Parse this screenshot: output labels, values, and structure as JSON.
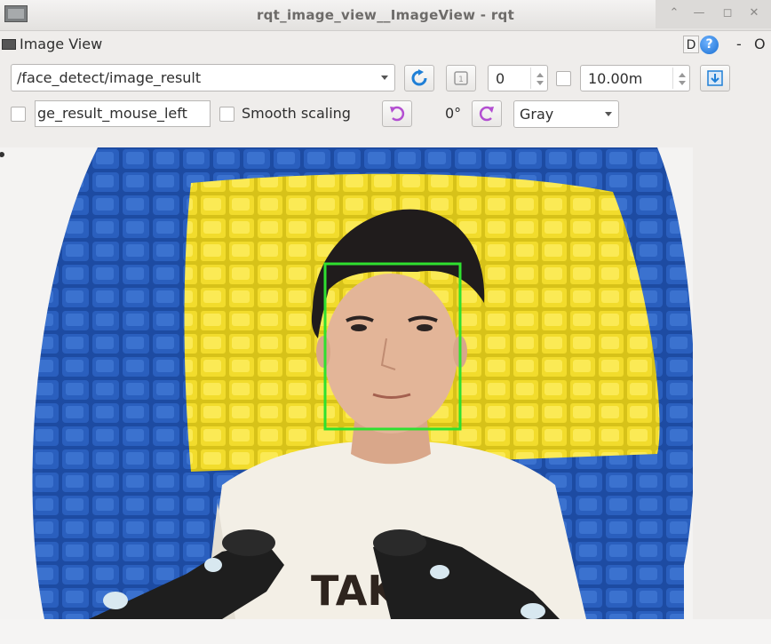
{
  "window": {
    "title": "rqt_image_view__ImageView - rqt"
  },
  "dock": {
    "title": "Image View",
    "d_label": "D",
    "help_label": "?",
    "dash_label": "-",
    "o_label": "O"
  },
  "toolbar1": {
    "topic_value": "/face_detect/image_result",
    "num_value": "0",
    "time_value": "10.00m"
  },
  "toolbar2": {
    "mouse_topic_value": "ge_result_mouse_left",
    "smooth_label": "Smooth scaling",
    "rotation_label": "0°",
    "color_mode": "Gray"
  },
  "image": {
    "shirt_text": "TAK",
    "face_box_color": "#2fe02f"
  }
}
